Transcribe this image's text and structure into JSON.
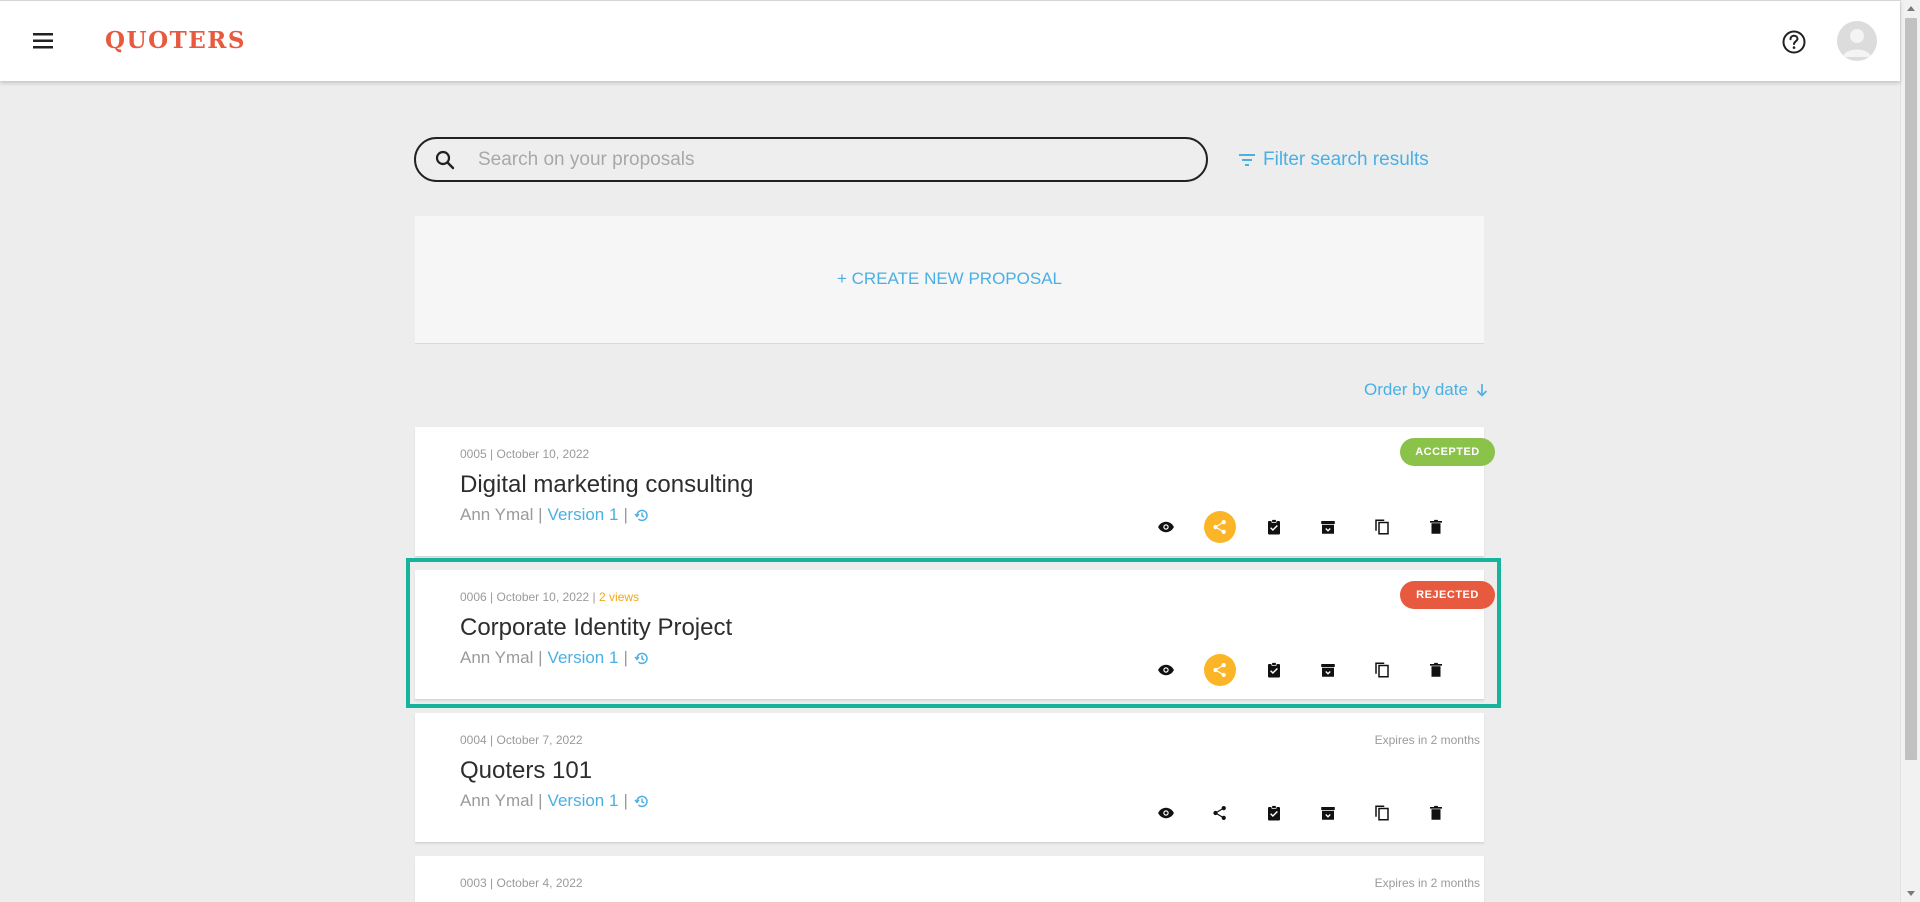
{
  "header": {
    "logo": "QUOTERS"
  },
  "search": {
    "placeholder": "Search on your proposals",
    "filter_label": "Filter search results"
  },
  "create": {
    "label": "+ CREATE NEW PROPOSAL"
  },
  "order": {
    "label": "Order by date"
  },
  "colors": {
    "accent_blue": "#4ab0e3",
    "logo_red": "#e85a40",
    "accepted_green": "#8bc34a",
    "rejected_red": "#e85a40",
    "share_orange": "#fbb526",
    "highlight_teal": "#17b49b"
  },
  "proposals": [
    {
      "meta": "0005 | October 10, 2022",
      "views": "",
      "title": "Digital marketing consulting",
      "owner": "Ann Ymal |",
      "version": "Version 1",
      "sep": "|",
      "status": "ACCEPTED",
      "expiry": ""
    },
    {
      "meta": "0006 | October 10, 2022 |",
      "views": "2 views",
      "title": "Corporate Identity Project",
      "owner": "Ann Ymal |",
      "version": "Version 1",
      "sep": "|",
      "status": "REJECTED",
      "expiry": ""
    },
    {
      "meta": "0004 | October 7, 2022",
      "views": "",
      "title": "Quoters 101",
      "owner": "Ann Ymal |",
      "version": "Version 1",
      "sep": "|",
      "status": "",
      "expiry": "Expires in 2 months"
    },
    {
      "meta": "0003 | October 4, 2022",
      "views": "",
      "title": "",
      "owner": "",
      "version": "",
      "sep": "",
      "status": "",
      "expiry": "Expires in 2 months"
    }
  ],
  "icons": [
    "menu-icon",
    "help-icon",
    "avatar-icon",
    "search-icon",
    "filter-icon",
    "arrow-down-icon",
    "history-icon",
    "eye-icon",
    "share-icon",
    "clipboard-check-icon",
    "archive-icon",
    "copy-icon",
    "trash-icon"
  ]
}
